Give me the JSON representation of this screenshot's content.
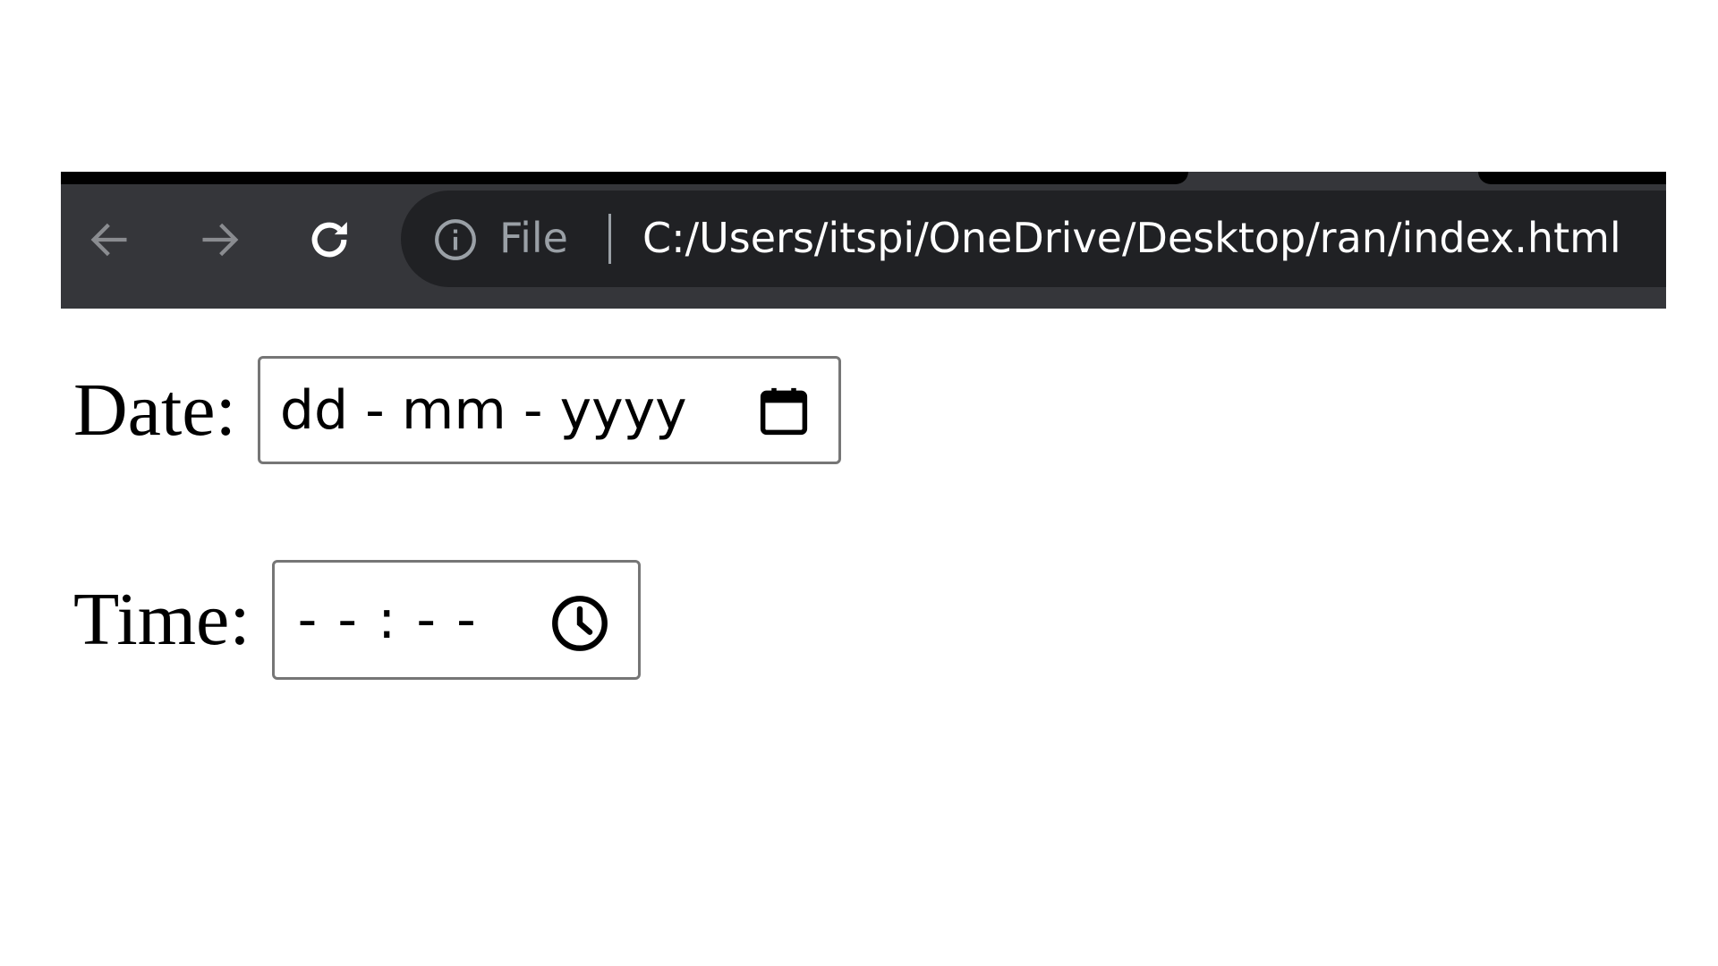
{
  "browser": {
    "omnibox": {
      "scheme_label": "File",
      "url": "C:/Users/itspi/OneDrive/Desktop/ran/index.html"
    },
    "icons": {
      "back": "arrow-left-icon",
      "forward": "arrow-right-icon",
      "reload": "reload-icon",
      "site_info": "info-circle-icon"
    }
  },
  "form": {
    "date": {
      "label": "Date:",
      "placeholder": "dd - mm - yyyy",
      "icon": "calendar-icon"
    },
    "time": {
      "label": "Time:",
      "placeholder": "- - : - -",
      "icon": "clock-icon"
    }
  },
  "colors": {
    "chrome_bg": "#35363a",
    "omnibox_bg": "#202124",
    "tabstrip_dark": "#000000",
    "url_text": "#ffffff",
    "scheme_text": "#9aa0a6",
    "disabled_nav": "#8a8c90",
    "input_border": "#767676"
  }
}
